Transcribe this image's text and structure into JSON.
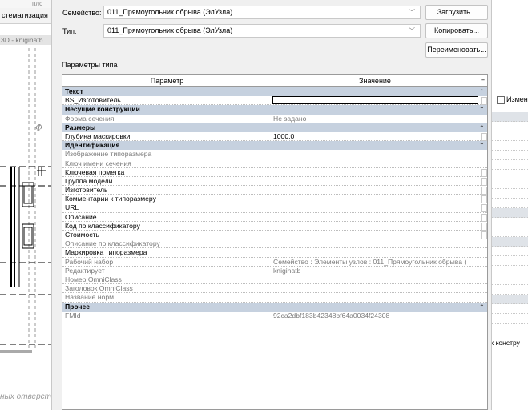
{
  "background": {
    "tab_label": "стематизация",
    "view_label": "3D - kniginatb",
    "italic_text": "ных отверст",
    "right_button": "Измен",
    "right_text": "х констру",
    "top_text": "плс"
  },
  "dialog": {
    "family_label": "Семейство:",
    "family_value": "011_Прямоугольник обрыва (ЭлУзла)",
    "type_label": "Тип:",
    "type_value": "011_Прямоугольник обрыва (ЭлУзла)",
    "load_button": "Загрузить...",
    "copy_button": "Копировать...",
    "rename_button": "Переименовать...",
    "type_params_label": "Параметры типа",
    "grid": {
      "col_param": "Параметр",
      "col_value": "Значение",
      "col_extra": "="
    }
  },
  "rows": [
    {
      "kind": "group",
      "label": "Текст",
      "toggle": "⌃"
    },
    {
      "kind": "row",
      "label": "BS_Изготовитель",
      "value": "",
      "editing": true,
      "gray": false,
      "check": false
    },
    {
      "kind": "group",
      "label": "Несущие конструкции",
      "toggle": "⌃"
    },
    {
      "kind": "row",
      "label": "Форма сечения",
      "value": "Не задано",
      "gray": true,
      "check": false
    },
    {
      "kind": "group",
      "label": "Размеры",
      "toggle": "⌃"
    },
    {
      "kind": "row",
      "label": "Глубина маскировки",
      "value": "1000,0",
      "gray": false,
      "check": true
    },
    {
      "kind": "group",
      "label": "Идентификация",
      "toggle": "⌃"
    },
    {
      "kind": "row",
      "label": "Изображение типоразмера",
      "value": "",
      "gray": true,
      "check": false
    },
    {
      "kind": "row",
      "label": "Ключ имени сечения",
      "value": "",
      "gray": true,
      "check": false
    },
    {
      "kind": "row",
      "label": "Ключевая пометка",
      "value": "",
      "gray": false,
      "check": true
    },
    {
      "kind": "row",
      "label": "Группа модели",
      "value": "",
      "gray": false,
      "check": true
    },
    {
      "kind": "row",
      "label": "Изготовитель",
      "value": "",
      "gray": false,
      "check": true
    },
    {
      "kind": "row",
      "label": "Комментарии к типоразмеру",
      "value": "",
      "gray": false,
      "check": true
    },
    {
      "kind": "row",
      "label": "URL",
      "value": "",
      "gray": false,
      "check": true
    },
    {
      "kind": "row",
      "label": "Описание",
      "value": "",
      "gray": false,
      "check": true
    },
    {
      "kind": "row",
      "label": "Код по классификатору",
      "value": "",
      "gray": false,
      "check": true
    },
    {
      "kind": "row",
      "label": "Стоимость",
      "value": "",
      "gray": false,
      "check": true
    },
    {
      "kind": "row",
      "label": "Описание по классификатору",
      "value": "",
      "gray": true,
      "check": false
    },
    {
      "kind": "row",
      "label": "Маркировка типоразмера",
      "value": "",
      "gray": false,
      "check": false
    },
    {
      "kind": "row",
      "label": "Рабочий набор",
      "value": "Семейство : Элементы узлов : 011_Прямоугольник обрыва (",
      "gray": true,
      "check": false
    },
    {
      "kind": "row",
      "label": "Редактирует",
      "value": "kniginatb",
      "gray": true,
      "check": false
    },
    {
      "kind": "row",
      "label": "Номер OmniClass",
      "value": "",
      "gray": true,
      "check": false
    },
    {
      "kind": "row",
      "label": "Заголовок OmniClass",
      "value": "",
      "gray": true,
      "check": false
    },
    {
      "kind": "row",
      "label": "Название норм",
      "value": "",
      "gray": true,
      "check": false
    },
    {
      "kind": "group",
      "label": "Прочее",
      "toggle": "⌃"
    },
    {
      "kind": "row",
      "label": "FMId",
      "value": "92ca2dbf183b42348bf64a0034f24308",
      "gray": true,
      "check": false
    }
  ]
}
